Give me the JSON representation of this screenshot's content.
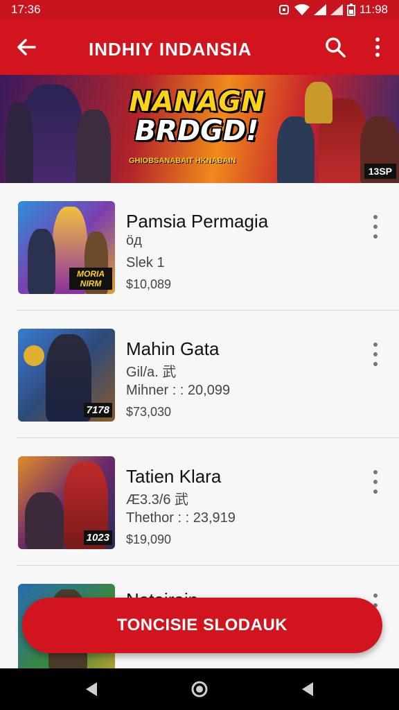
{
  "status_bar": {
    "time_left": "17:36",
    "time_right": "11:98"
  },
  "app_bar": {
    "title": "INDHIY INDANSIA"
  },
  "banner": {
    "title_line1": "NANAGN",
    "title_line2": "BRDGD!",
    "subtitle": "GHIOBSANABAIT HKNABAIN",
    "badge": "13SP"
  },
  "games": [
    {
      "name": "Pamsia Permagia",
      "line1": "öд",
      "line2": "Slek 1",
      "price": "$10,089",
      "thumb_badge": "MORIA NIRM"
    },
    {
      "name": "Mahin Gata",
      "line1": "Gil/a. 武",
      "line2": "Mihner : : 20,099",
      "price": "$73,030",
      "thumb_badge": "7178"
    },
    {
      "name": "Tatien Klara",
      "line1": "Æ3.3/6 武",
      "line2": "Thethor : : 23,919",
      "price": "$19,090",
      "thumb_badge": "1023"
    },
    {
      "name": "Natairain"
    }
  ],
  "cta": {
    "label": "TONCISIE SLODAUK"
  },
  "colors": {
    "brand_red": "#d2141f",
    "status_red": "#c8141f",
    "list_bg": "#f7f7f7"
  }
}
